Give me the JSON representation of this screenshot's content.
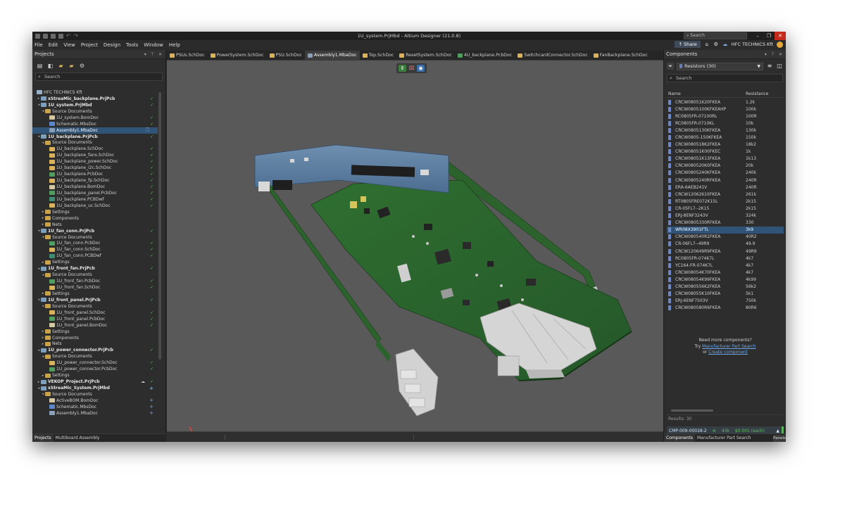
{
  "app": {
    "title": "1U_system.PrjMbd - Altium Designer (21.0.8)",
    "search_placeholder": "Search",
    "share_label": "Share",
    "org_name": "HFC TECHNICS Kft"
  },
  "menu": [
    "File",
    "Edit",
    "View",
    "Project",
    "Design",
    "Tools",
    "Window",
    "Help"
  ],
  "projects_panel": {
    "title": "Projects",
    "search_placeholder": "Search",
    "bottom_tabs": [
      "Projects",
      "Multiboard Assembly"
    ],
    "tree": [
      {
        "label": "HFC TECHNICS Kft",
        "indent": 0,
        "icon": "org",
        "tw": ""
      },
      {
        "label": "xStreaMic_backplane.PrjPcb",
        "indent": 1,
        "icon": "proj",
        "tw": "▸",
        "mark": "check",
        "bold": true
      },
      {
        "label": "1U_system.PrjMbd",
        "indent": 1,
        "icon": "proj",
        "tw": "◂",
        "mark": "check",
        "bold": true
      },
      {
        "label": "Source Documents",
        "indent": 2,
        "icon": "folder",
        "tw": "◂"
      },
      {
        "label": "1U_system.BomDoc",
        "indent": 3,
        "icon": "bom",
        "tw": "",
        "mark": "check"
      },
      {
        "label": "Schematic.MbsDoc",
        "indent": 3,
        "icon": "mbs",
        "tw": "",
        "mark": "check"
      },
      {
        "label": "Assembly1.MbaDoc",
        "indent": 3,
        "icon": "mba",
        "tw": "",
        "selected": true,
        "docicon": true
      },
      {
        "label": "1U_backplane.PrjPcb",
        "indent": 1,
        "icon": "proj",
        "tw": "◂",
        "mark": "check",
        "bold": true
      },
      {
        "label": "Source Documents",
        "indent": 2,
        "icon": "folder",
        "tw": "◂"
      },
      {
        "label": "1U_backplane.SchDoc",
        "indent": 3,
        "icon": "sch",
        "tw": "",
        "mark": "check"
      },
      {
        "label": "1U_backplane_fans.SchDoc",
        "indent": 3,
        "icon": "sch",
        "tw": "",
        "mark": "check"
      },
      {
        "label": "1U_backplane_power.SchDoc",
        "indent": 3,
        "icon": "sch",
        "tw": "",
        "mark": "check"
      },
      {
        "label": "1U_backplane_i2c.SchDoc",
        "indent": 3,
        "icon": "sch",
        "tw": "",
        "mark": "check"
      },
      {
        "label": "1U_backplane.PcbDoc",
        "indent": 3,
        "icon": "pcb",
        "tw": "",
        "mark": "check"
      },
      {
        "label": "1U_backplane_fp.SchDoc",
        "indent": 3,
        "icon": "sch",
        "tw": "",
        "mark": "check"
      },
      {
        "label": "1U_backplane.BomDoc",
        "indent": 3,
        "icon": "bom",
        "tw": "",
        "mark": "check"
      },
      {
        "label": "1U_backplane_panel.PcbDoc",
        "indent": 3,
        "icon": "pcb",
        "tw": "",
        "mark": "check"
      },
      {
        "label": "1U_backplane.PCBDwf",
        "indent": 3,
        "icon": "dwf",
        "tw": "",
        "mark": "check"
      },
      {
        "label": "1U_backplane_uc.SchDoc",
        "indent": 3,
        "icon": "sch",
        "tw": "",
        "mark": "check"
      },
      {
        "label": "Settings",
        "indent": 2,
        "icon": "folder",
        "tw": "▸"
      },
      {
        "label": "Components",
        "indent": 2,
        "icon": "folder",
        "tw": "▸"
      },
      {
        "label": "Nets",
        "indent": 2,
        "icon": "folder",
        "tw": "▸"
      },
      {
        "label": "1U_fan_conn.PrjPcb",
        "indent": 1,
        "icon": "proj",
        "tw": "◂",
        "mark": "check",
        "bold": true
      },
      {
        "label": "Source Documents",
        "indent": 2,
        "icon": "folder",
        "tw": "◂"
      },
      {
        "label": "1U_fan_conn.PcbDoc",
        "indent": 3,
        "icon": "pcb",
        "tw": "",
        "mark": "check"
      },
      {
        "label": "1U_fan_conn.SchDoc",
        "indent": 3,
        "icon": "sch",
        "tw": "",
        "mark": "check"
      },
      {
        "label": "1U_fan_conn.PCBDwf",
        "indent": 3,
        "icon": "dwf",
        "tw": "",
        "mark": "check"
      },
      {
        "label": "Settings",
        "indent": 2,
        "icon": "folder",
        "tw": "▸"
      },
      {
        "label": "1U_front_fan.PrjPcb",
        "indent": 1,
        "icon": "proj",
        "tw": "◂",
        "mark": "check",
        "bold": true
      },
      {
        "label": "Source Documents",
        "indent": 2,
        "icon": "folder",
        "tw": "◂"
      },
      {
        "label": "1U_front_fan.PcbDoc",
        "indent": 3,
        "icon": "pcb",
        "tw": "",
        "mark": "check"
      },
      {
        "label": "1U_front_fan.SchDoc",
        "indent": 3,
        "icon": "sch",
        "tw": "",
        "mark": "check"
      },
      {
        "label": "Settings",
        "indent": 2,
        "icon": "folder",
        "tw": "▸"
      },
      {
        "label": "1U_front_panel.PrjPcb",
        "indent": 1,
        "icon": "proj",
        "tw": "◂",
        "mark": "check",
        "bold": true
      },
      {
        "label": "Source Documents",
        "indent": 2,
        "icon": "folder",
        "tw": "◂"
      },
      {
        "label": "1U_front_panel.SchDoc",
        "indent": 3,
        "icon": "sch",
        "tw": "",
        "mark": "check"
      },
      {
        "label": "1U_front_panel.PcbDoc",
        "indent": 3,
        "icon": "pcb",
        "tw": "",
        "mark": "check"
      },
      {
        "label": "1U_front_panel.BomDoc",
        "indent": 3,
        "icon": "bom",
        "tw": "",
        "mark": "check"
      },
      {
        "label": "Settings",
        "indent": 2,
        "icon": "folder",
        "tw": "▸"
      },
      {
        "label": "Components",
        "indent": 2,
        "icon": "folder",
        "tw": "▸"
      },
      {
        "label": "Nets",
        "indent": 2,
        "icon": "folder",
        "tw": "▸"
      },
      {
        "label": "1U_power_connector.PrjPcb",
        "indent": 1,
        "icon": "proj",
        "tw": "◂",
        "mark": "check",
        "bold": true
      },
      {
        "label": "Source Documents",
        "indent": 2,
        "icon": "folder",
        "tw": "◂"
      },
      {
        "label": "1U_power_connector.SchDoc",
        "indent": 3,
        "icon": "sch",
        "tw": "",
        "mark": "check"
      },
      {
        "label": "1U_power_connector.PcbDoc",
        "indent": 3,
        "icon": "pcb",
        "tw": "",
        "mark": "check"
      },
      {
        "label": "Settings",
        "indent": 2,
        "icon": "folder",
        "tw": "▸"
      },
      {
        "label": "VEKOP_Project.PrjPcb",
        "indent": 1,
        "icon": "proj",
        "tw": "▸",
        "mark": "check",
        "cloud": true,
        "bold": true
      },
      {
        "label": "xStreaMic_System.PrjMbd",
        "indent": 1,
        "icon": "proj",
        "tw": "◂",
        "mark": "plus",
        "bold": true
      },
      {
        "label": "Source Documents",
        "indent": 2,
        "icon": "folder",
        "tw": "◂"
      },
      {
        "label": "ActiveBOM.BomDoc",
        "indent": 3,
        "icon": "bom",
        "tw": "",
        "mark": "plus"
      },
      {
        "label": "Schematic.MbsDoc",
        "indent": 3,
        "icon": "mbs",
        "tw": "",
        "mark": "plus"
      },
      {
        "label": "Assembly1.MbaDoc",
        "indent": 3,
        "icon": "mba",
        "tw": "",
        "mark": "plus"
      }
    ]
  },
  "doc_tabs": [
    {
      "label": "PSUs.SchDoc",
      "icon": "sch"
    },
    {
      "label": "PowerSystem.SchDoc",
      "icon": "sch"
    },
    {
      "label": "PSU.SchDoc",
      "icon": "sch"
    },
    {
      "label": "Assembly1.MbaDoc",
      "icon": "mba",
      "active": true
    },
    {
      "label": "Top.SchDoc",
      "icon": "sch"
    },
    {
      "label": "ResetSystem.SchDoc",
      "icon": "sch"
    },
    {
      "label": "4U_backplane.PcbDoc",
      "icon": "pcb"
    },
    {
      "label": "SwitchcardConnector.SchDoc",
      "icon": "sch"
    },
    {
      "label": "FanBackplane.SchDoc",
      "icon": "sch"
    }
  ],
  "components_panel": {
    "title": "Components",
    "filter_label": "Resistors  (30)",
    "search_placeholder": "Search",
    "columns": [
      "Name",
      "Resistance"
    ],
    "rows": [
      [
        "CRCW08051K20FKEA",
        "1.2k"
      ],
      [
        "CRCW0805100KFKEAHP",
        "100k"
      ],
      [
        "RC0805FR-07100RL",
        "100R"
      ],
      [
        "RC0805FR-0710KL",
        "10k"
      ],
      [
        "CRCW0805130KFKEA",
        "130k"
      ],
      [
        "CRCW0805-150KFKEA",
        "150k"
      ],
      [
        "CRCW080518K2FKEA",
        "18k2"
      ],
      [
        "CRCW08051K00FKEC",
        "1k"
      ],
      [
        "CRCW08051K13FKEA",
        "1k13"
      ],
      [
        "CRCW080520K0FKEA",
        "20k"
      ],
      [
        "CRCW0805240KFKEA",
        "240k"
      ],
      [
        "CRCW0805240RFKEA",
        "240R"
      ],
      [
        "ERA-6AEB241V",
        "240R"
      ],
      [
        "CRCW12062610FKEA",
        "261k"
      ],
      [
        "RT0805FRE072K15L",
        "2k15"
      ],
      [
        "CR-05FL7--2K15",
        "2k15"
      ],
      [
        "ERJ-8ENF3243V",
        "324k"
      ],
      [
        "CRCW0805330RFKEA",
        "330"
      ],
      [
        "WR08X3901FTL",
        "3k9"
      ],
      [
        "CRCW080540R2FKEA",
        "40R2"
      ],
      [
        "CR-06FL7--49R9",
        "49.9"
      ],
      [
        "CRCW120649R9FKEA",
        "49R9"
      ],
      [
        "RC0805FR-074K7L",
        "4k7"
      ],
      [
        "YC164-FR-074K7L",
        "4k7"
      ],
      [
        "CRCW08054K70FKEA",
        "4k7"
      ],
      [
        "CRCW08054K99FKEA",
        "4k99"
      ],
      [
        "CRCW080556K2FKEA",
        "56k2"
      ],
      [
        "CRCW08055K10FKEA",
        "5k1"
      ],
      [
        "ERJ-6ENF7503V",
        "750k"
      ],
      [
        "CRCW080580R6FKEA",
        "80R6"
      ]
    ],
    "selected_index": 18,
    "more_title": "Need more components?",
    "more_try": "Try",
    "more_link1": "Manufacturer Part Search",
    "more_or": "or",
    "more_link2": "Create component",
    "results": "Results: 30",
    "part_number": "CMP-009-00028-2",
    "part_stock": "43k",
    "part_price": "$0.001 (each)",
    "bottom_tabs": [
      "Components",
      "Manufacturer Part Search"
    ],
    "panels_btn": "Panels"
  },
  "icons": {
    "app_icons": [
      "save-icon",
      "open-icon",
      "folder-icon",
      "undo-icon",
      "redo-icon"
    ],
    "search_icon": "search-icon",
    "home_icon": "home-icon",
    "gear_icon": "gear-icon",
    "cloud_icon": "cloud-icon"
  },
  "colors": {
    "selection": "#2f5478",
    "board_green": "#2f6b2f",
    "backplane_blue": "#5f7fa0",
    "viewport_bg": "#595959"
  }
}
